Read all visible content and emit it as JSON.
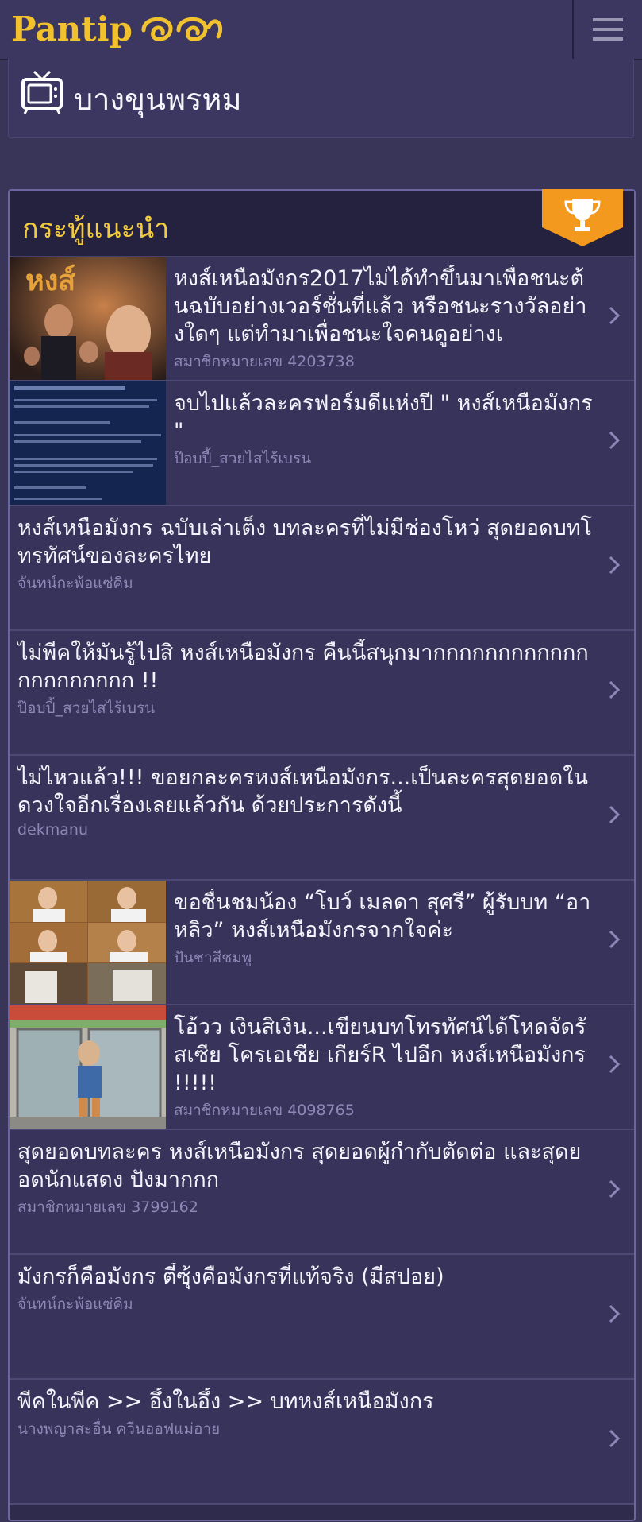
{
  "header": {
    "logo_text": "Pantip",
    "menu_icon": "hamburger-icon"
  },
  "room": {
    "name": "บางขุนพรหม",
    "icon": "tv-icon"
  },
  "recommended": {
    "title": "กระทู้แนะนำ",
    "badge_icon": "trophy-icon",
    "items": [
      {
        "title": "หงส์เหนือมังกร2017ไม่ได้ทำขึ้นมาเพื่อชนะต้นฉบับอย่างเวอร์ชั่นที่แล้ว หรือชนะรางวัลอย่างใดๆ แต่ทำมาเพื่อชนะใจคนดูอย่างเ",
        "author": "สมาชิกหมายเลข 4203738",
        "thumb": "poster"
      },
      {
        "title": "จบไปแล้วละครฟอร์มดีแห่งปี \" หงส์เหนือมังกร \"",
        "author": "ป๊อบปี้_สวยไสไร้เบรน",
        "thumb": "doc"
      },
      {
        "title": "หงส์เหนือมังกร ฉบับเล่าเต็ง บทละครที่ไม่มีช่องโหว่ สุดยอดบทโทรทัศน์ของละครไทย",
        "author": "จันทน์กะพ้อแซ่คิม",
        "thumb": ""
      },
      {
        "title": "ไม่พีคให้มันรู้ไปสิ หงส์เหนือมังกร คืนนี้สนุกมากกกกกกกกกกกกกกกกกกกกก !!",
        "author": "ป๊อบปี้_สวยไสไร้เบรน",
        "thumb": ""
      },
      {
        "title": "ไม่ไหวแล้ว!!! ขอยกละครหงส์เหนือมังกร...เป็นละครสุดยอดในดวงใจอีกเรื่องเลยแล้วกัน ด้วยประการดังนี้",
        "author": "dekmanu",
        "thumb": ""
      },
      {
        "title": "ขอชื่นชมน้อง “โบว์ เมลดา สุศรี” ผู้รับบท “อาหลิว” หงส์เหนือมังกรจากใจค่ะ",
        "author": "ปันชาสีชมพู",
        "thumb": "collage"
      },
      {
        "title": "โอ้วว เงินสิเงิน...เขียนบทโทรทัศน์ได้โหดจัดรัสเซีย โครเอเชีย เกียร์R ไปอีก หงส์เหนือมังกร !!!!!",
        "author": "สมาชิกหมายเลข 4098765",
        "thumb": "door"
      },
      {
        "title": "สุดยอดบทละคร หงส์เหนือมังกร สุดยอดผู้กำกับตัดต่อ และสุดยอดนักแสดง ปังมากกก",
        "author": "สมาชิกหมายเลข 3799162",
        "thumb": ""
      },
      {
        "title": "มังกรก็คือมังกร ตี๋ซุ้งคือมังกรที่แท้จริง (มีสปอย)",
        "author": "จันทน์กะพ้อแซ่คิม",
        "thumb": ""
      },
      {
        "title": "พีคในพีค >> อึ้งในอึ้ง >> บทหงส์เหนือมังกร",
        "author": "นางพญาสะอื่น ควีนออฟแม่อาย",
        "thumb": ""
      }
    ]
  },
  "colors": {
    "background": "#393559",
    "accent_yellow": "#f3cb3c",
    "trophy_orange": "#f39a1e",
    "author_text": "#8e88b8"
  }
}
